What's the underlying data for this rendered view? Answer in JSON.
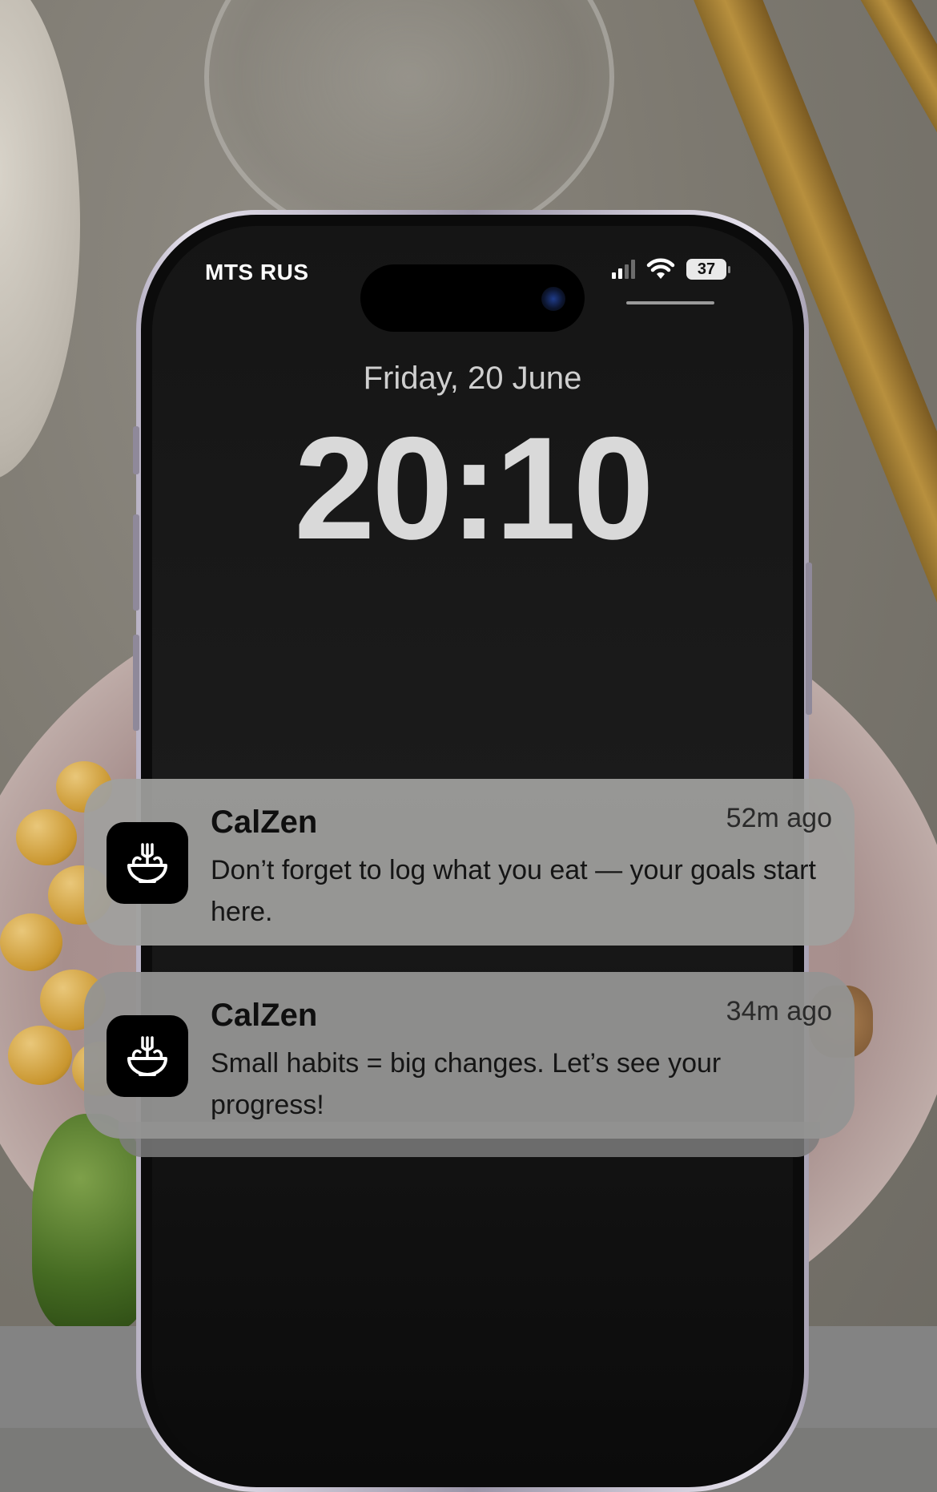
{
  "status_bar": {
    "carrier": "MTS RUS",
    "battery_level": "37",
    "signal_icon": "cellular-signal-icon",
    "wifi_icon": "wifi-icon",
    "battery_icon": "battery-icon"
  },
  "lock_screen": {
    "date": "Friday, 20 June",
    "time": "20:10"
  },
  "notifications": [
    {
      "app_name": "CalZen",
      "time_ago": "52m ago",
      "message": "Don’t forget to log what you eat — your goals start here.",
      "icon": "salad-bowl-icon"
    },
    {
      "app_name": "CalZen",
      "time_ago": "34m ago",
      "message": "Small habits = big changes. Let’s see your progress!",
      "icon": "salad-bowl-icon"
    }
  ],
  "colors": {
    "screen_bg": "#151515",
    "notification_bg": "#a0a09e",
    "app_icon_bg": "#000000",
    "clock_text": "#d9d9d9"
  }
}
